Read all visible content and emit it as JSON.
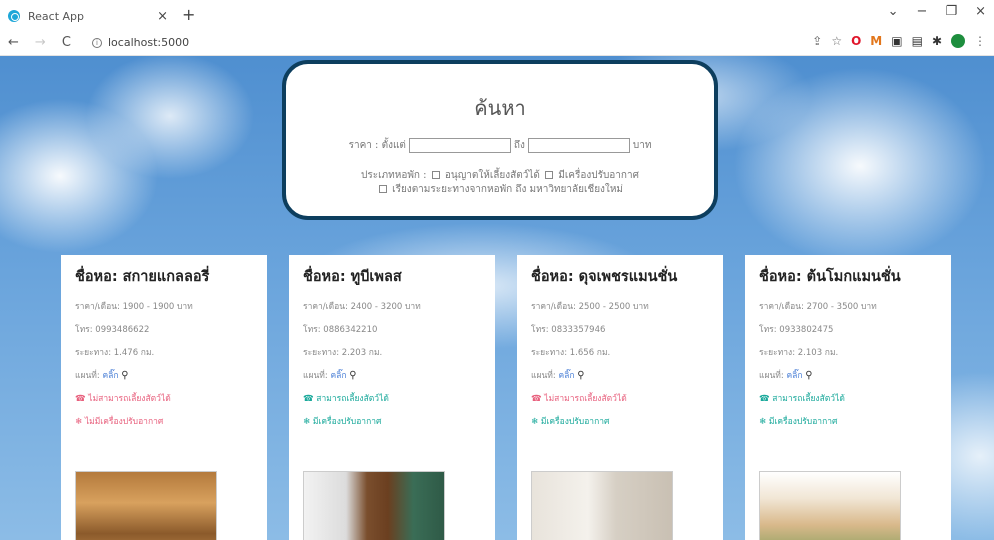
{
  "browser": {
    "tab_title": "React App",
    "tab_close": "×",
    "new_tab": "+",
    "url": "localhost:5000",
    "win_min": "−",
    "win_max": "❐",
    "win_close": "×",
    "back": "←",
    "forward": "→",
    "reload": "C"
  },
  "search": {
    "title": "ค้นหา",
    "price_label": "ราคา : ตั้งแต่",
    "price_from_value": "",
    "to_label": "ถึง",
    "price_to_value": "",
    "currency": "บาท",
    "type_label": "ประเภทหอพัก :",
    "pets_label": "อนุญาตให้เลี้ยงสัตว์ได้",
    "ac_label": "มีเครื่องปรับอากาศ",
    "sort_label": "เรียงตามระยะทางจากหอพัก ถึง มหาวิทยาลัยเชียงใหม่"
  },
  "cards": [
    {
      "name": "ชื่อหอ: สกายแกลลอรี่",
      "price": "ราคา/เดือน: 1900 - 1900 บาท",
      "phone": "โทร: 0993486622",
      "distance": "ระยะทาง: 1.476 กม.",
      "map_label": "แผนที่:",
      "map_link": "คลิ๊ก",
      "pets": "☎ ไม่สามารถเลี้ยงสัตว์ได้",
      "ac": "❄ ไม่มีเครื่องปรับอากาศ",
      "pets_ok": false,
      "ac_ok": false
    },
    {
      "name": "ชื่อหอ: ทูบีเพลส",
      "price": "ราคา/เดือน: 2400 - 3200 บาท",
      "phone": "โทร: 0886342210",
      "distance": "ระยะทาง: 2.203 กม.",
      "map_label": "แผนที่:",
      "map_link": "คลิ๊ก",
      "pets": "☎ สามารถเลี้ยงสัตว์ได้",
      "ac": "❄ มีเครื่องปรับอากาศ",
      "pets_ok": true,
      "ac_ok": true
    },
    {
      "name": "ชื่อหอ: ดุจเพชรแมนชั่น",
      "price": "ราคา/เดือน: 2500 - 2500 บาท",
      "phone": "โทร: 0833357946",
      "distance": "ระยะทาง: 1.656 กม.",
      "map_label": "แผนที่:",
      "map_link": "คลิ๊ก",
      "pets": "☎ ไม่สามารถเลี้ยงสัตว์ได้",
      "ac": "❄ มีเครื่องปรับอากาศ",
      "pets_ok": false,
      "ac_ok": true
    },
    {
      "name": "ชื่อหอ: ต้นโมกแมนชั่น",
      "price": "ราคา/เดือน: 2700 - 3500 บาท",
      "phone": "โทร: 0933802475",
      "distance": "ระยะทาง: 2.103 กม.",
      "map_label": "แผนที่:",
      "map_link": "คลิ๊ก",
      "pets": "☎ สามารถเลี้ยงสัตว์ได้",
      "ac": "❄ มีเครื่องปรับอากาศ",
      "pets_ok": true,
      "ac_ok": true
    }
  ]
}
